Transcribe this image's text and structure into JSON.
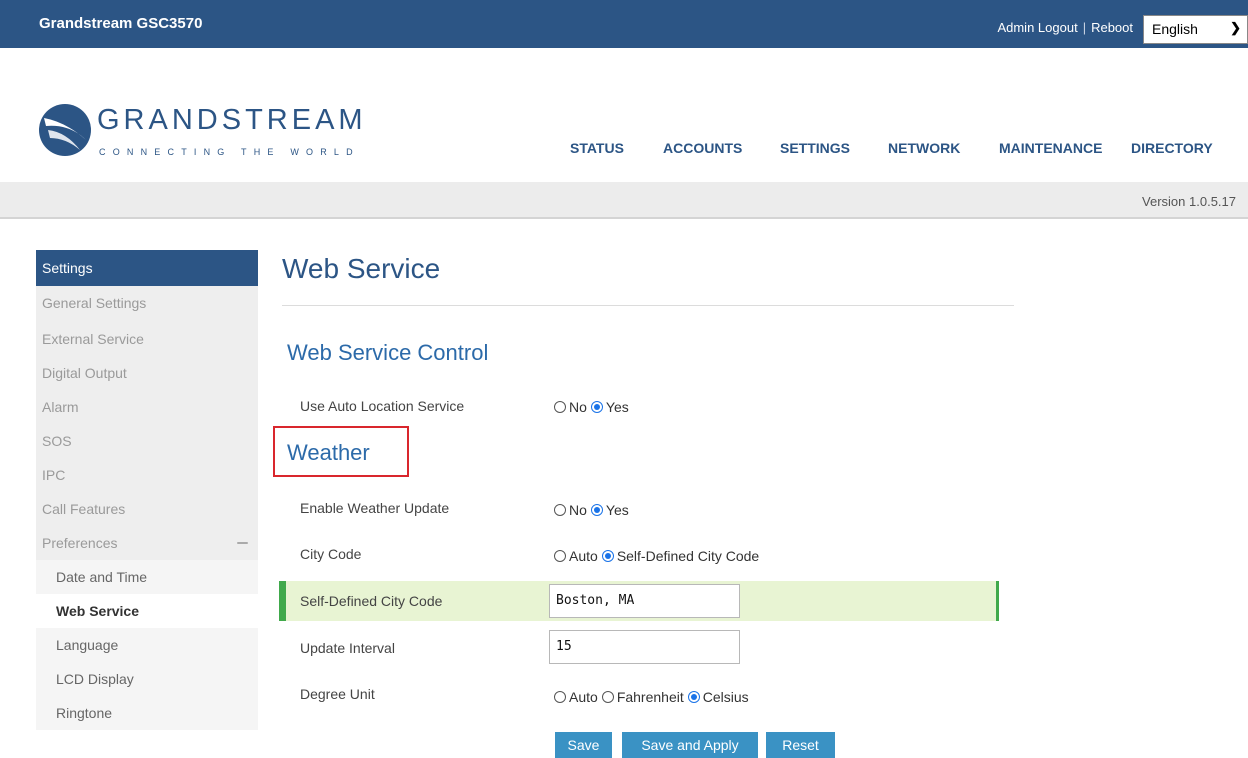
{
  "topbar": {
    "title": "Grandstream GSC3570",
    "admin_logout": "Admin Logout",
    "separator": "|",
    "reboot": "Reboot",
    "language": "English"
  },
  "brand": {
    "logo_word": "GRANDSTREAM",
    "tagline": "CONNECTING THE WORLD"
  },
  "nav": {
    "items": [
      "STATUS",
      "ACCOUNTS",
      "SETTINGS",
      "NETWORK",
      "MAINTENANCE",
      "DIRECTORY"
    ]
  },
  "version": "Version 1.0.5.17",
  "sidebar": {
    "header": "Settings",
    "items": [
      "General Settings",
      "External Service",
      "Digital Output",
      "Alarm",
      "SOS",
      "IPC",
      "Call Features",
      "Preferences"
    ],
    "sub_items": [
      "Date and Time",
      "Web Service",
      "Language",
      "LCD Display",
      "Ringtone"
    ],
    "active": "Web Service"
  },
  "page": {
    "title": "Web Service",
    "section_control": "Web Service Control",
    "section_weather": "Weather"
  },
  "form": {
    "auto_location": {
      "label": "Use Auto Location Service",
      "options": [
        "No",
        "Yes"
      ],
      "selected": "Yes"
    },
    "weather_update": {
      "label": "Enable Weather Update",
      "options": [
        "No",
        "Yes"
      ],
      "selected": "Yes"
    },
    "city_code": {
      "label": "City Code",
      "options": [
        "Auto",
        "Self-Defined City Code"
      ],
      "selected": "Self-Defined City Code"
    },
    "self_defined_city": {
      "label": "Self-Defined City Code",
      "value": "Boston, MA"
    },
    "update_interval": {
      "label": "Update Interval",
      "value": "15"
    },
    "degree_unit": {
      "label": "Degree Unit",
      "options": [
        "Auto",
        "Fahrenheit",
        "Celsius"
      ],
      "selected": "Celsius"
    }
  },
  "buttons": {
    "save": "Save",
    "save_apply": "Save and Apply",
    "reset": "Reset"
  },
  "colors": {
    "brand_blue": "#2c5585",
    "section_blue": "#2c6aa9",
    "highlight_red": "#d9262d",
    "row_highlight": "#e8f4d3",
    "row_accent": "#40a94b",
    "button": "#3a92c4"
  }
}
